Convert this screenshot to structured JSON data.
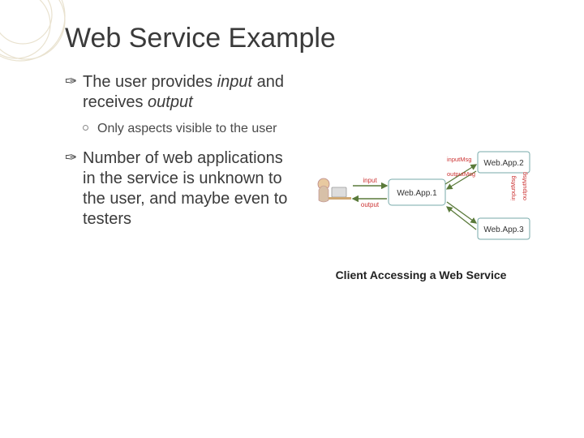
{
  "title": "Web Service Example",
  "bullets": {
    "b1_pre": "The user provides ",
    "b1_input": "input",
    "b1_mid": " and receives ",
    "b1_output": "output",
    "b2": "Only aspects visible to the user",
    "b3": "Number of web applications in the service is unknown to the user, and maybe even to testers"
  },
  "diagram": {
    "caption": "Client Accessing a Web Service",
    "client": "",
    "arrows": {
      "input": "input",
      "output": "output",
      "inputMsg1": "inputMsg",
      "outputMsg1": "outputMsg",
      "inputMsg2": "inputMsg",
      "outputMsg2": "outputMsg"
    },
    "apps": {
      "app1": "Web.App.1",
      "app2": "Web.App.2",
      "app3": "Web.App.3"
    }
  }
}
